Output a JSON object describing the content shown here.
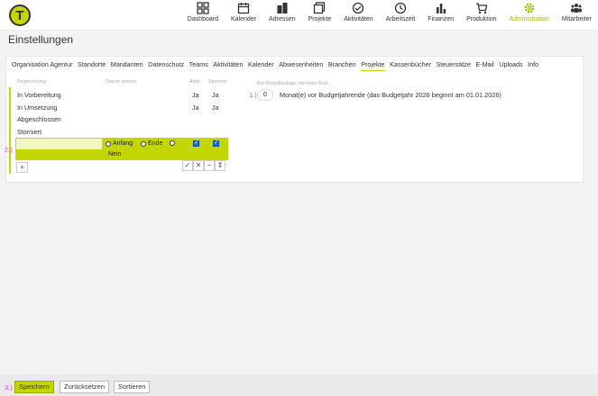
{
  "header": {
    "logo_letter": "T",
    "accent_color": "#c4d600",
    "nav": [
      {
        "label": "Dashboard",
        "icon": "dashboard-grid-icon"
      },
      {
        "label": "Kalender",
        "icon": "calendar-icon"
      },
      {
        "label": "Adressen",
        "icon": "buildings-icon"
      },
      {
        "label": "Projekte",
        "icon": "projects-icon"
      },
      {
        "label": "Aktivitäten",
        "icon": "activity-check-icon"
      },
      {
        "label": "Arbeitszeit",
        "icon": "clock-icon"
      },
      {
        "label": "Finanzen",
        "icon": "bar-chart-icon"
      },
      {
        "label": "Produktion",
        "icon": "cart-icon"
      },
      {
        "label": "Administration",
        "icon": "gear-icon",
        "active": true
      },
      {
        "label": "Mitarbeiter",
        "icon": "people-icon"
      }
    ]
  },
  "page": {
    "title": "Einstellungen"
  },
  "tabs": [
    "Organisation Agentur",
    "Standorte",
    "Mandanten",
    "Datenschutz",
    "Teams",
    "Aktivitäten",
    "Kalender",
    "Abwesenheiten",
    "Branchen",
    "Projekte",
    "Kassenbücher",
    "Steuersätze",
    "E-Mail",
    "Uploads",
    "Info"
  ],
  "active_tab": "Projekte",
  "table": {
    "headers": {
      "name": "Bezeichnung",
      "date": "Datum setzen",
      "active": "Aktiv",
      "lock": "Sperren"
    },
    "rows": [
      {
        "name": "In Vorbereitung",
        "active": "Ja",
        "lock": "Ja"
      },
      {
        "name": "In Umsetzung",
        "active": "Ja",
        "lock": "Ja"
      },
      {
        "name": "Abgeschlossen",
        "active": "",
        "lock": ""
      },
      {
        "name": "Storniert",
        "active": "",
        "lock": ""
      }
    ],
    "new_row": {
      "radio_start": "Anfang",
      "radio_end": "Ende",
      "selected": "Nein"
    }
  },
  "budget": {
    "hint": "Bei Projektanlage nächstes Bud...",
    "value": "0",
    "text": "Monat(e) vor Budgetjahrende (das Budgetjahr 2026 beginnt am 01.01.2026)"
  },
  "markers": {
    "one": "1.)",
    "two": "2.)",
    "three": "3.)"
  },
  "footer": {
    "save": "Speichern",
    "reset": "Zurücksetzen",
    "sort": "Sortieren"
  }
}
